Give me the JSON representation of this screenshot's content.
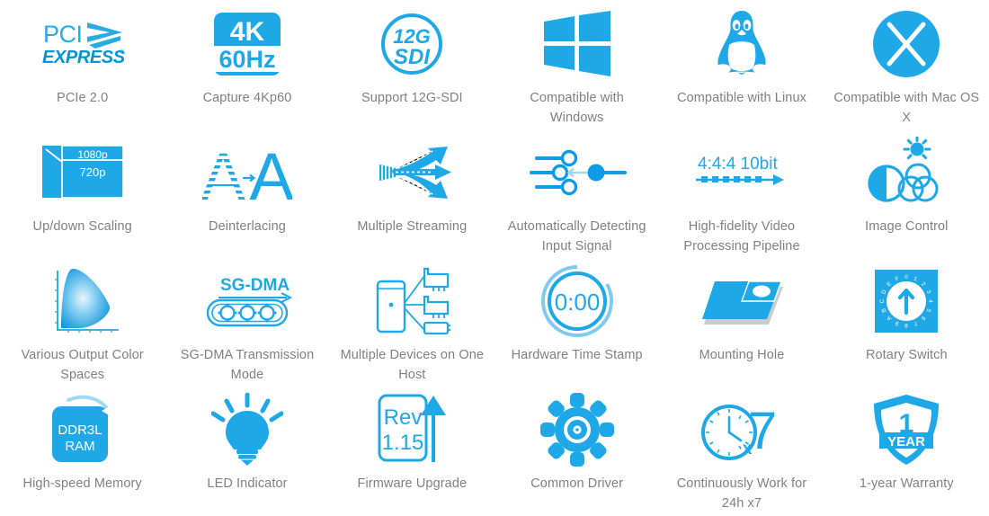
{
  "page": {
    "background_color": "#ffffff",
    "brand_blue": "#1EA8E8",
    "brand_blue_dark": "#0092DC",
    "label_color": "#808080",
    "columns": 6,
    "rows": 4
  },
  "features": [
    {
      "id": "pcie-2-0",
      "icon": "pci-express-logo-icon",
      "label": "PCIe 2.0",
      "icon_text": [
        "PCI",
        "EXPRESS"
      ]
    },
    {
      "id": "capture-4kp60",
      "icon": "4k-60hz-badge-icon",
      "label": "Capture 4Kp60",
      "icon_text": [
        "4K",
        "60Hz"
      ]
    },
    {
      "id": "support-12g-sdi",
      "icon": "12g-sdi-circle-icon",
      "label": "Support 12G-SDI",
      "icon_text": [
        "12G",
        "SDI"
      ]
    },
    {
      "id": "compatible-windows",
      "icon": "windows-logo-icon",
      "label": "Compatible with Windows",
      "icon_text": []
    },
    {
      "id": "compatible-linux",
      "icon": "linux-penguin-icon",
      "label": "Compatible with Linux",
      "icon_text": []
    },
    {
      "id": "compatible-macosx",
      "icon": "mac-os-x-circle-icon",
      "label": "Compatible with Mac OS X",
      "icon_text": [
        "X"
      ]
    },
    {
      "id": "up-down-scaling",
      "icon": "resolution-scaling-icon",
      "label": "Up/down Scaling",
      "icon_text": [
        "1080p",
        "720p"
      ]
    },
    {
      "id": "deinterlacing",
      "icon": "deinterlacing-aa-icon",
      "label": "Deinterlacing",
      "icon_text": [
        "A",
        "A"
      ]
    },
    {
      "id": "multiple-streaming",
      "icon": "multiple-streaming-arrows-icon",
      "label": "Multiple Streaming",
      "icon_text": []
    },
    {
      "id": "auto-detect-input",
      "icon": "signal-sliders-icon",
      "label": "Automatically Detecting Input Signal",
      "icon_text": []
    },
    {
      "id": "high-fidelity-pipeline",
      "icon": "444-10bit-pipeline-icon",
      "label": "High-fidelity Video Processing Pipeline",
      "icon_text": [
        "4:4:4 10bit"
      ]
    },
    {
      "id": "image-control",
      "icon": "brightness-color-wheels-icon",
      "label": "Image Control",
      "icon_text": []
    },
    {
      "id": "output-color-spaces",
      "icon": "color-gamut-chart-icon",
      "label": "Various Output Color Spaces",
      "icon_text": []
    },
    {
      "id": "sg-dma-mode",
      "icon": "sg-dma-gears-icon",
      "label": "SG-DMA Transmission Mode",
      "icon_text": [
        "SG-DMA"
      ]
    },
    {
      "id": "multiple-devices-one-host",
      "icon": "multi-device-host-icon",
      "label": "Multiple Devices on One Host",
      "icon_text": []
    },
    {
      "id": "hardware-time-stamp",
      "icon": "stopwatch-timer-icon",
      "label": "Hardware Time Stamp",
      "icon_text": [
        "0:00"
      ]
    },
    {
      "id": "mounting-hole",
      "icon": "mounting-hole-plate-icon",
      "label": "Mounting Hole",
      "icon_text": []
    },
    {
      "id": "rotary-switch",
      "icon": "rotary-switch-dial-icon",
      "label": "Rotary Switch",
      "icon_text": [
        "0",
        "1",
        "2",
        "3",
        "4",
        "5",
        "6",
        "7",
        "8",
        "9",
        "A",
        "B",
        "C",
        "D",
        "E",
        "F"
      ]
    },
    {
      "id": "high-speed-memory",
      "icon": "ddr3l-ram-chip-icon",
      "label": "High-speed Memory",
      "icon_text": [
        "DDR3L",
        "RAM"
      ]
    },
    {
      "id": "led-indicator",
      "icon": "light-bulb-icon",
      "label": "LED Indicator",
      "icon_text": []
    },
    {
      "id": "firmware-upgrade",
      "icon": "firmware-revision-arrow-icon",
      "label": "Firmware Upgrade",
      "icon_text": [
        "Rev",
        "1.15"
      ]
    },
    {
      "id": "common-driver",
      "icon": "gear-cog-icon",
      "label": "Common Driver",
      "icon_text": []
    },
    {
      "id": "continuous-work",
      "icon": "clock-x7-icon",
      "label": "Continuously Work for 24h x7",
      "icon_text": [
        "x7"
      ]
    },
    {
      "id": "one-year-warranty",
      "icon": "warranty-shield-icon",
      "label": "1-year Warranty",
      "icon_text": [
        "1",
        "YEAR"
      ]
    }
  ]
}
